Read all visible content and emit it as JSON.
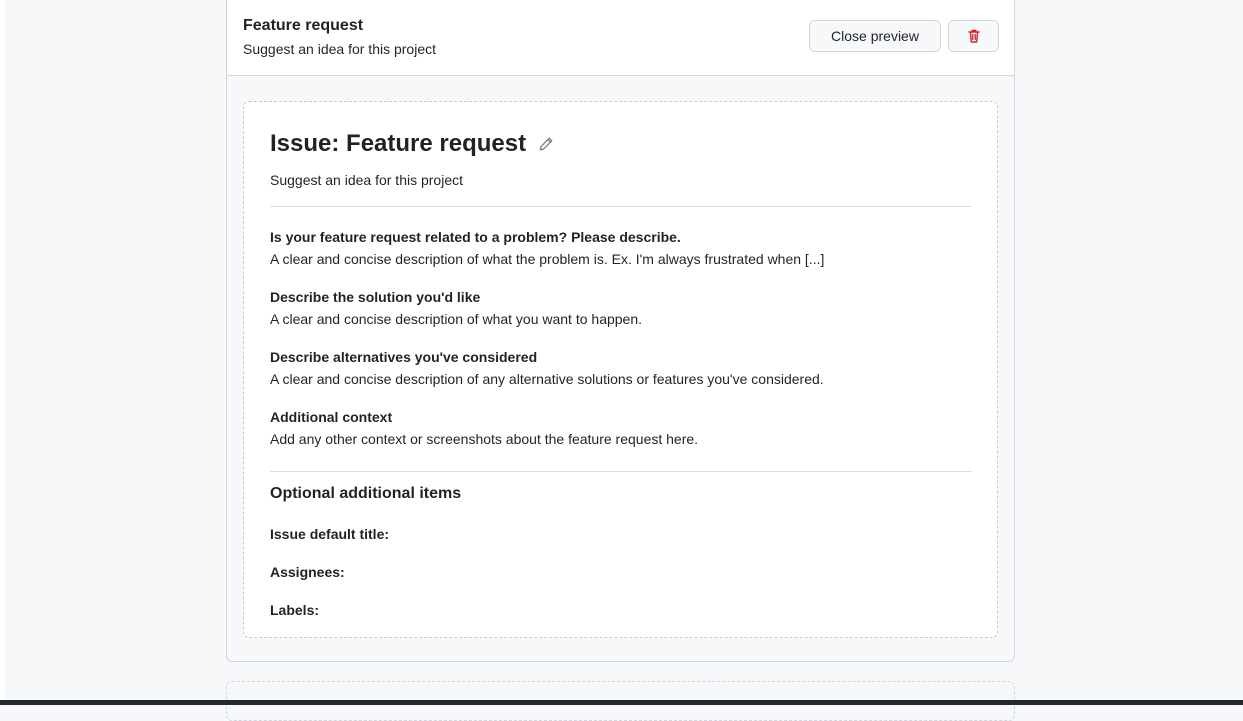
{
  "header": {
    "title": "Feature request",
    "subtitle": "Suggest an idea for this project",
    "close_preview_label": "Close preview",
    "delete_icon": "trash-icon",
    "delete_color": "#cf222e"
  },
  "preview": {
    "title": "Issue: Feature request",
    "edit_icon": "pencil-icon",
    "subtitle": "Suggest an idea for this project",
    "sections": [
      {
        "heading": "Is your feature request related to a problem? Please describe.",
        "body": "A clear and concise description of what the problem is. Ex. I'm always frustrated when [...]"
      },
      {
        "heading": "Describe the solution you'd like",
        "body": "A clear and concise description of what you want to happen."
      },
      {
        "heading": "Describe alternatives you've considered",
        "body": "A clear and concise description of any alternative solutions or features you've considered."
      },
      {
        "heading": "Additional context",
        "body": "Add any other context or screenshots about the feature request here."
      }
    ],
    "optional": {
      "heading": "Optional additional items",
      "default_title_label": "Issue default title:",
      "assignees_label": "Assignees:",
      "labels_label": "Labels:"
    }
  }
}
